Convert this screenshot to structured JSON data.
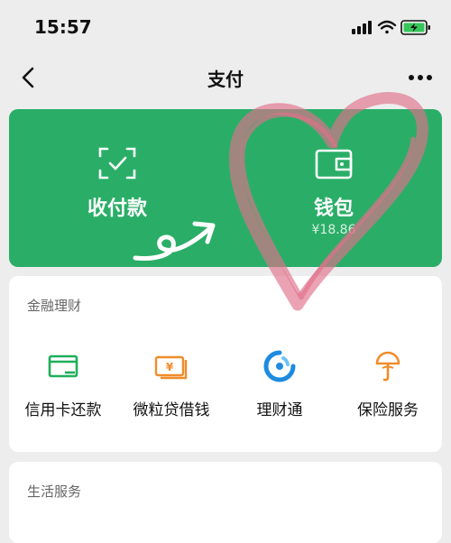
{
  "status_bar": {
    "time": "15:57"
  },
  "nav": {
    "title": "支付"
  },
  "wallet_card": {
    "collect_pay": {
      "label": "收付款",
      "icon": "scan-check-icon"
    },
    "wallet": {
      "label": "钱包",
      "amount": "¥18.86",
      "icon": "wallet-icon"
    }
  },
  "finance": {
    "title": "金融理财",
    "items": [
      {
        "label": "信用卡还款",
        "icon": "credit-card-icon",
        "color": "#1fae5a"
      },
      {
        "label": "微粒贷借钱",
        "icon": "money-bill-icon",
        "color": "#f08c2a"
      },
      {
        "label": "理财通",
        "icon": "wealth-icon",
        "color": "#1e8be0"
      },
      {
        "label": "保险服务",
        "icon": "umbrella-icon",
        "color": "#f08c2a"
      }
    ]
  },
  "life": {
    "title": "生活服务"
  },
  "colors": {
    "brand_green": "#2aae67",
    "background": "#ededed"
  }
}
